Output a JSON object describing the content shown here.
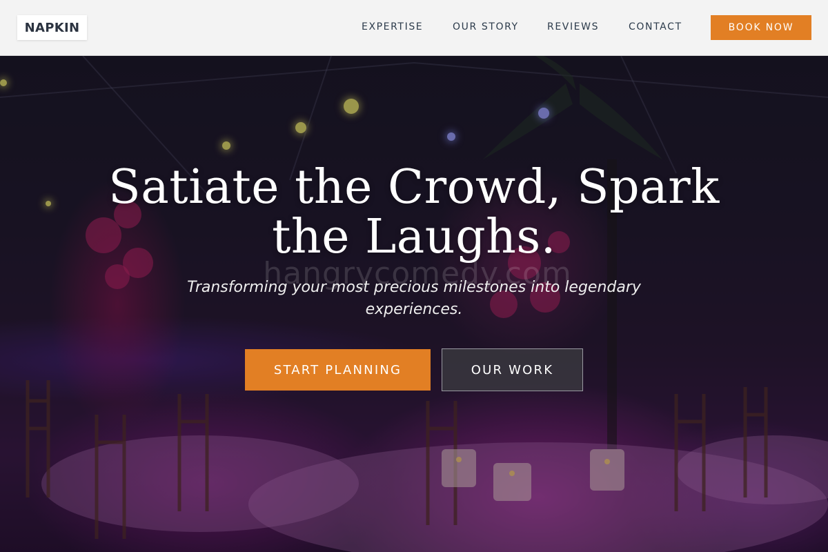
{
  "header": {
    "logo": "NAPKIN",
    "nav": [
      {
        "label": "EXPERTISE"
      },
      {
        "label": "OUR STORY"
      },
      {
        "label": "REVIEWS"
      },
      {
        "label": "CONTACT"
      }
    ],
    "cta_label": "BOOK NOW"
  },
  "hero": {
    "title_line1": "Satiate the Crowd, Spark",
    "title_line2": "the Laughs.",
    "subtitle": "Transforming your most precious milestones into legendary experiences.",
    "watermark": "hangrycomedy.com",
    "primary_button": "START PLANNING",
    "secondary_button": "OUR WORK",
    "background_image": "event-banquet-hall-tables-purple-lighting"
  },
  "colors": {
    "accent": "#e27f24",
    "header_bg": "#f3f3f3",
    "nav_text": "#2b3a4a"
  }
}
